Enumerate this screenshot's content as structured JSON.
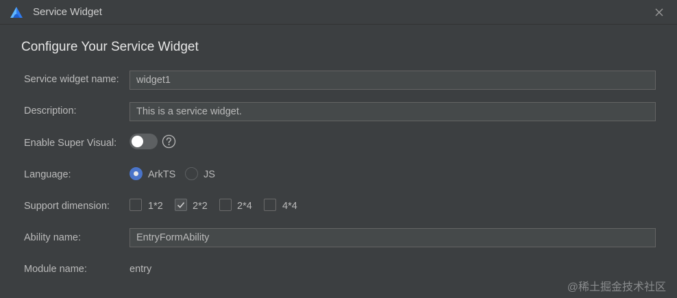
{
  "window": {
    "title": "Service Widget",
    "app_icon": "deveco-logo-icon",
    "close_icon": "close-icon"
  },
  "form": {
    "heading": "Configure Your Service Widget",
    "widget_name": {
      "label": "Service widget name:",
      "value": "widget1"
    },
    "description": {
      "label": "Description:",
      "value": "This is a service widget."
    },
    "super_visual": {
      "label": "Enable Super Visual:",
      "enabled": false,
      "help_icon": "question-circle-icon"
    },
    "language": {
      "label": "Language:",
      "options": [
        {
          "label": "ArkTS",
          "selected": true
        },
        {
          "label": "JS",
          "selected": false
        }
      ]
    },
    "support_dimension": {
      "label": "Support dimension:",
      "options": [
        {
          "label": "1*2",
          "checked": false
        },
        {
          "label": "2*2",
          "checked": true
        },
        {
          "label": "2*4",
          "checked": false
        },
        {
          "label": "4*4",
          "checked": false
        }
      ]
    },
    "ability_name": {
      "label": "Ability name:",
      "value": "EntryFormAbility"
    },
    "module_name": {
      "label": "Module name:",
      "value": "entry"
    }
  },
  "watermark": "@稀土掘金技术社区",
  "colors": {
    "background": "#3c3f41",
    "field_background": "#45494a",
    "accent": "#4a74c9",
    "text": "#bbbbbb"
  }
}
